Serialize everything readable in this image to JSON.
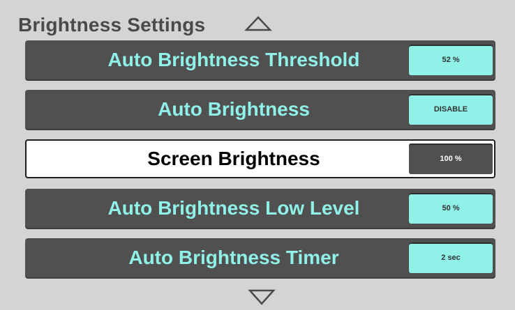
{
  "header": {
    "title": "Brightness Settings"
  },
  "navigation": {
    "up_icon": "triangle-up-icon",
    "down_icon": "triangle-down-icon"
  },
  "colors": {
    "background": "#d4d4d4",
    "row_background": "#505050",
    "accent": "#8ff1e8",
    "selected_background": "#ffffff",
    "title_text": "#4a4a4a"
  },
  "settings": [
    {
      "label": "Auto Brightness Threshold",
      "value": "52 %",
      "selected": false
    },
    {
      "label": "Auto Brightness",
      "value": "DISABLE",
      "selected": false
    },
    {
      "label": "Screen Brightness",
      "value": "100 %",
      "selected": true
    },
    {
      "label": "Auto Brightness Low Level",
      "value": "50 %",
      "selected": false
    },
    {
      "label": "Auto Brightness Timer",
      "value": "2 sec",
      "selected": false
    }
  ]
}
